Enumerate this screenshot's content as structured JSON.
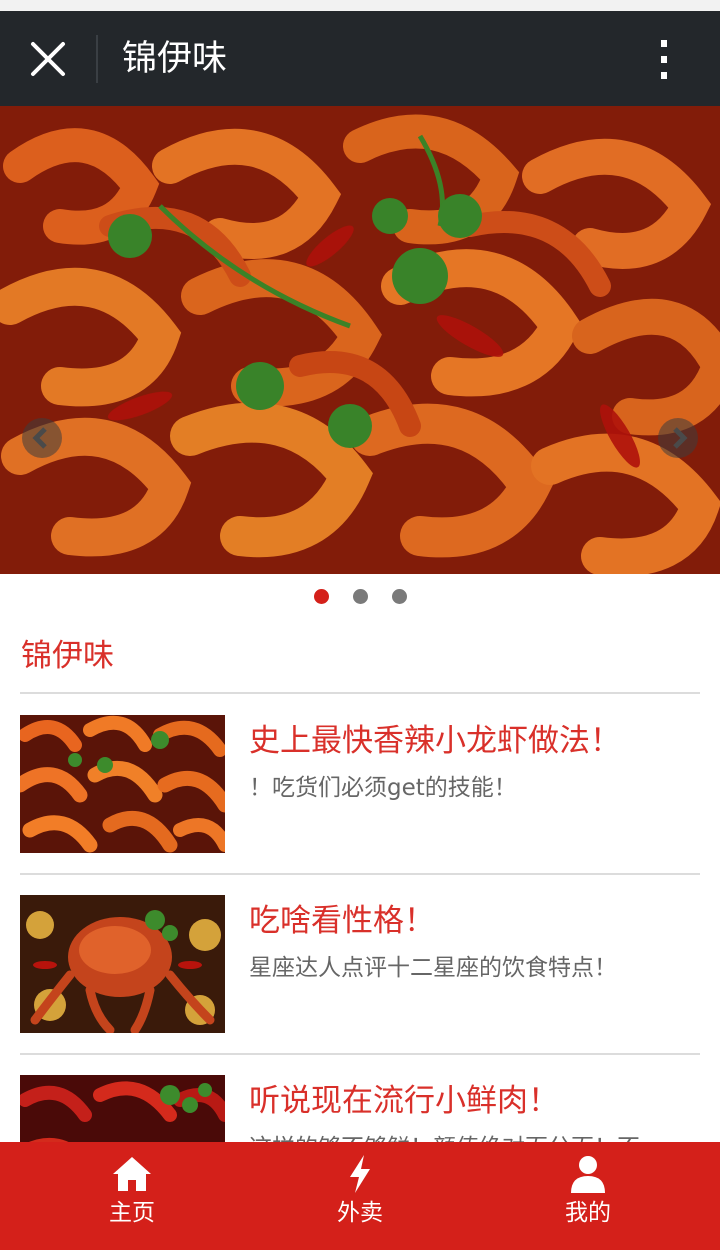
{
  "header": {
    "title": "锦伊味",
    "close_icon": "close-icon",
    "more_icon": "more-vertical-icon"
  },
  "banner": {
    "image": "spicy-shrimp-photo",
    "prev_icon": "chevron-left-icon",
    "next_icon": "chevron-right-icon",
    "slides": 3,
    "active_slide": 1
  },
  "section": {
    "title": "锦伊味"
  },
  "articles": [
    {
      "title": "史上最快香辣小龙虾做法！",
      "desc": "！吃货们必须get的技能！",
      "thumb": "spicy-shrimp-thumbnail"
    },
    {
      "title": "吃啥看性格！",
      "desc": "星座达人点评十二星座的饮食特点！",
      "thumb": "spicy-crab-thumbnail"
    },
    {
      "title": "听说现在流行小鲜肉！",
      "desc": "这样的够不够鲜！颜值绝对百分百！不",
      "thumb": "crayfish-thumbnail"
    }
  ],
  "bottom_nav": [
    {
      "label": "主页",
      "icon": "home-icon"
    },
    {
      "label": "外卖",
      "icon": "lightning-icon"
    },
    {
      "label": "我的",
      "icon": "user-icon"
    }
  ],
  "colors": {
    "accent": "#d4201a",
    "title_text": "#d9302a",
    "topbar": "#23272b",
    "desc_text": "#666666"
  }
}
